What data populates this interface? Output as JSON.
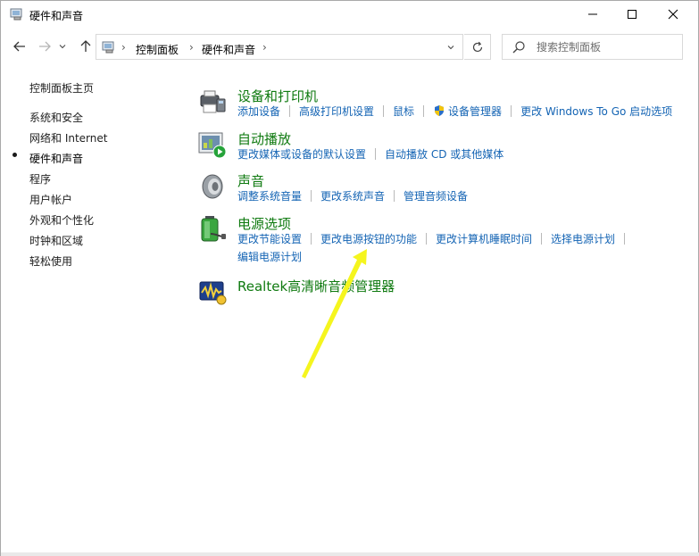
{
  "window": {
    "title": "硬件和声音"
  },
  "address_bar": {
    "segments": [
      "控制面板",
      "硬件和声音"
    ],
    "search_placeholder": "搜索控制面板"
  },
  "sidebar": {
    "items": [
      {
        "label": "控制面板主页"
      },
      {
        "label": "系统和安全"
      },
      {
        "label": "网络和 Internet"
      },
      {
        "label": "硬件和声音"
      },
      {
        "label": "程序"
      },
      {
        "label": "用户帐户"
      },
      {
        "label": "外观和个性化"
      },
      {
        "label": "时钟和区域"
      },
      {
        "label": "轻松使用"
      }
    ],
    "active_index": 3
  },
  "categories": [
    {
      "title": "设备和打印机",
      "icon": "printer-icon",
      "links": [
        "添加设备",
        "高级打印机设置",
        "鼠标",
        "设备管理器",
        "更改 Windows To Go 启动选项"
      ]
    },
    {
      "title": "自动播放",
      "icon": "autoplay-icon",
      "links": [
        "更改媒体或设备的默认设置",
        "自动播放 CD 或其他媒体"
      ]
    },
    {
      "title": "声音",
      "icon": "speaker-icon",
      "links": [
        "调整系统音量",
        "更改系统声音",
        "管理音频设备"
      ]
    },
    {
      "title": "电源选项",
      "icon": "battery-icon",
      "links": [
        "更改节能设置",
        "更改电源按钮的功能",
        "更改计算机睡眠时间",
        "选择电源计划",
        "编辑电源计划"
      ]
    },
    {
      "title": "Realtek高清晰音频管理器",
      "icon": "realtek-audio-icon",
      "links": []
    }
  ],
  "colors": {
    "category_title": "#0f7a10",
    "link": "#1464b4",
    "annotation_arrow": "#f5f51e"
  }
}
